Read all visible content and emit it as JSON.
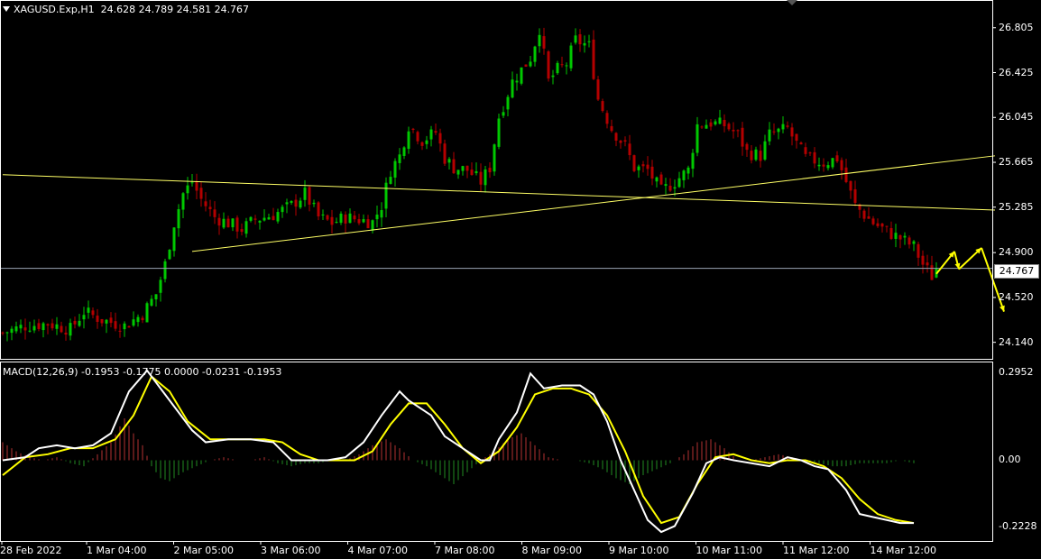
{
  "header": {
    "symbol": "XAGUSD.Exp,H1",
    "ohlc": "24.628 24.789 24.581 24.767"
  },
  "macd_header": {
    "text": "MACD(12,26,9) -0.1953 -0.1775 0.0000 -0.0231 -0.1953"
  },
  "current_price_label": "24.767",
  "colors": {
    "background": "#000000",
    "bull_candle": "#00c800",
    "bear_candle": "#b40000",
    "trendline": "#ffff66",
    "macd_line": "#ffffff",
    "signal_line": "#ffff00",
    "hist_positive": "#b43232",
    "hist_negative": "#228b22",
    "arrow": "#ffff00"
  },
  "chart_data": [
    {
      "type": "candlestick",
      "symbol": "XAGUSD.Exp",
      "timeframe": "H1",
      "ylim": [
        24.0,
        27.04
      ],
      "y_ticks": [
        "26.805",
        "26.425",
        "26.045",
        "25.665",
        "25.285",
        "24.900",
        "24.520",
        "24.140"
      ],
      "current_price": 24.767,
      "x_ticks": [
        "28 Feb 2022",
        "1 Mar 04:00",
        "2 Mar 05:00",
        "3 Mar 06:00",
        "4 Mar 07:00",
        "7 Mar 08:00",
        "8 Mar 09:00",
        "9 Mar 10:00",
        "10 Mar 11:00",
        "11 Mar 12:00",
        "14 Mar 12:00"
      ],
      "close_path": [
        [
          0,
          24.22
        ],
        [
          5,
          24.28
        ],
        [
          10,
          24.3
        ],
        [
          15,
          24.25
        ],
        [
          18,
          24.4
        ],
        [
          22,
          24.33
        ],
        [
          27,
          24.28
        ],
        [
          31,
          24.38
        ],
        [
          34,
          24.55
        ],
        [
          36,
          24.8
        ],
        [
          38,
          25.15
        ],
        [
          40,
          25.4
        ],
        [
          42,
          25.5
        ],
        [
          44,
          25.35
        ],
        [
          47,
          25.2
        ],
        [
          50,
          25.15
        ],
        [
          53,
          25.1
        ],
        [
          56,
          25.18
        ],
        [
          60,
          25.22
        ],
        [
          64,
          25.3
        ],
        [
          67,
          25.4
        ],
        [
          70,
          25.2
        ],
        [
          73,
          25.15
        ],
        [
          76,
          25.2
        ],
        [
          79,
          25.18
        ],
        [
          82,
          25.16
        ],
        [
          84,
          25.3
        ],
        [
          86,
          25.6
        ],
        [
          88,
          25.72
        ],
        [
          90,
          25.98
        ],
        [
          93,
          25.85
        ],
        [
          96,
          25.92
        ],
        [
          98,
          25.7
        ],
        [
          100,
          25.62
        ],
        [
          103,
          25.6
        ],
        [
          106,
          25.5
        ],
        [
          108,
          25.62
        ],
        [
          110,
          26.05
        ],
        [
          113,
          26.35
        ],
        [
          117,
          26.55
        ],
        [
          119,
          26.8
        ],
        [
          121,
          26.35
        ],
        [
          123,
          26.45
        ],
        [
          125,
          26.5
        ],
        [
          127,
          26.7
        ],
        [
          130,
          26.65
        ],
        [
          132,
          26.2
        ],
        [
          135,
          25.95
        ],
        [
          138,
          25.8
        ],
        [
          140,
          25.62
        ],
        [
          143,
          25.6
        ],
        [
          146,
          25.42
        ],
        [
          149,
          25.5
        ],
        [
          152,
          25.6
        ],
        [
          154,
          25.98
        ],
        [
          157,
          26.0
        ],
        [
          160,
          25.98
        ],
        [
          163,
          25.9
        ],
        [
          165,
          25.75
        ],
        [
          168,
          25.72
        ],
        [
          170,
          25.9
        ],
        [
          174,
          25.95
        ],
        [
          176,
          25.82
        ],
        [
          178,
          25.7
        ],
        [
          182,
          25.66
        ],
        [
          185,
          25.7
        ],
        [
          187,
          25.5
        ],
        [
          189,
          25.3
        ],
        [
          191,
          25.22
        ],
        [
          193,
          25.15
        ],
        [
          196,
          25.08
        ],
        [
          199,
          25.02
        ],
        [
          202,
          24.95
        ],
        [
          204,
          24.8
        ],
        [
          206,
          24.7
        ],
        [
          207,
          24.77
        ]
      ],
      "trendlines": [
        {
          "from": [
            0,
            25.56
          ],
          "to": [
            220,
            25.26
          ]
        },
        {
          "from": [
            42,
            24.91
          ],
          "to": [
            220,
            25.72
          ]
        }
      ],
      "projection_arrows": [
        {
          "from": [
            207,
            24.72
          ],
          "to": [
            211,
            24.91
          ]
        },
        {
          "from": [
            211,
            24.91
          ],
          "to": [
            212,
            24.76
          ]
        },
        {
          "from": [
            212,
            24.76
          ],
          "to": [
            217,
            24.94
          ]
        },
        {
          "from": [
            217,
            24.94
          ],
          "to": [
            222,
            24.4
          ]
        }
      ]
    },
    {
      "type": "line",
      "name": "MACD(12,26,9)",
      "ylim": [
        -0.27,
        0.33
      ],
      "y_ticks": [
        "0.2952",
        "0.00",
        "-0.2228"
      ],
      "macd": [
        [
          0,
          0.0
        ],
        [
          5,
          0.01
        ],
        [
          8,
          0.04
        ],
        [
          12,
          0.05
        ],
        [
          16,
          0.04
        ],
        [
          20,
          0.05
        ],
        [
          24,
          0.09
        ],
        [
          28,
          0.23
        ],
        [
          32,
          0.3
        ],
        [
          35,
          0.24
        ],
        [
          38,
          0.18
        ],
        [
          42,
          0.1
        ],
        [
          45,
          0.06
        ],
        [
          50,
          0.07
        ],
        [
          55,
          0.07
        ],
        [
          60,
          0.06
        ],
        [
          64,
          0.0
        ],
        [
          68,
          0.0
        ],
        [
          72,
          0.0
        ],
        [
          76,
          0.01
        ],
        [
          80,
          0.06
        ],
        [
          84,
          0.15
        ],
        [
          88,
          0.23
        ],
        [
          90,
          0.2
        ],
        [
          95,
          0.15
        ],
        [
          98,
          0.08
        ],
        [
          102,
          0.04
        ],
        [
          106,
          0.0
        ],
        [
          108,
          0.0
        ],
        [
          110,
          0.07
        ],
        [
          114,
          0.16
        ],
        [
          117,
          0.29
        ],
        [
          120,
          0.24
        ],
        [
          124,
          0.25
        ],
        [
          128,
          0.25
        ],
        [
          131,
          0.22
        ],
        [
          134,
          0.13
        ],
        [
          137,
          0.0
        ],
        [
          140,
          -0.1
        ],
        [
          143,
          -0.2
        ],
        [
          146,
          -0.24
        ],
        [
          149,
          -0.22
        ],
        [
          153,
          -0.11
        ],
        [
          156,
          -0.01
        ],
        [
          159,
          0.01
        ],
        [
          162,
          0.0
        ],
        [
          166,
          -0.01
        ],
        [
          170,
          -0.02
        ],
        [
          174,
          0.01
        ],
        [
          177,
          0.0
        ],
        [
          180,
          -0.02
        ],
        [
          183,
          -0.03
        ],
        [
          187,
          -0.1
        ],
        [
          190,
          -0.18
        ],
        [
          193,
          -0.19
        ],
        [
          196,
          -0.2
        ],
        [
          199,
          -0.21
        ],
        [
          202,
          -0.21
        ]
      ],
      "signal": [
        [
          0,
          -0.05
        ],
        [
          5,
          0.01
        ],
        [
          10,
          0.02
        ],
        [
          15,
          0.04
        ],
        [
          20,
          0.04
        ],
        [
          25,
          0.07
        ],
        [
          29,
          0.15
        ],
        [
          33,
          0.28
        ],
        [
          37,
          0.23
        ],
        [
          41,
          0.13
        ],
        [
          46,
          0.07
        ],
        [
          52,
          0.07
        ],
        [
          58,
          0.07
        ],
        [
          62,
          0.06
        ],
        [
          66,
          0.02
        ],
        [
          70,
          0.0
        ],
        [
          74,
          0.0
        ],
        [
          78,
          0.0
        ],
        [
          82,
          0.03
        ],
        [
          86,
          0.12
        ],
        [
          90,
          0.19
        ],
        [
          94,
          0.19
        ],
        [
          98,
          0.12
        ],
        [
          102,
          0.04
        ],
        [
          106,
          -0.01
        ],
        [
          110,
          0.03
        ],
        [
          114,
          0.11
        ],
        [
          118,
          0.22
        ],
        [
          122,
          0.24
        ],
        [
          126,
          0.24
        ],
        [
          130,
          0.22
        ],
        [
          134,
          0.15
        ],
        [
          138,
          0.03
        ],
        [
          142,
          -0.12
        ],
        [
          146,
          -0.21
        ],
        [
          150,
          -0.19
        ],
        [
          154,
          -0.08
        ],
        [
          158,
          0.01
        ],
        [
          162,
          0.02
        ],
        [
          166,
          0.0
        ],
        [
          170,
          -0.01
        ],
        [
          174,
          0.0
        ],
        [
          178,
          0.0
        ],
        [
          182,
          -0.02
        ],
        [
          186,
          -0.06
        ],
        [
          190,
          -0.13
        ],
        [
          194,
          -0.18
        ],
        [
          198,
          -0.2
        ],
        [
          202,
          -0.21
        ]
      ],
      "histogram": [
        [
          0,
          0.06
        ],
        [
          3,
          0.03
        ],
        [
          6,
          0.01
        ],
        [
          9,
          0.0
        ],
        [
          12,
          0.01
        ],
        [
          15,
          -0.01
        ],
        [
          18,
          -0.02
        ],
        [
          21,
          0.02
        ],
        [
          24,
          0.06
        ],
        [
          27,
          0.14
        ],
        [
          29,
          0.09
        ],
        [
          31,
          0.05
        ],
        [
          33,
          -0.02
        ],
        [
          35,
          -0.06
        ],
        [
          37,
          -0.07
        ],
        [
          40,
          -0.04
        ],
        [
          43,
          -0.02
        ],
        [
          46,
          0.0
        ],
        [
          49,
          0.01
        ],
        [
          52,
          0.0
        ],
        [
          55,
          0.0
        ],
        [
          58,
          0.01
        ],
        [
          61,
          -0.01
        ],
        [
          64,
          -0.02
        ],
        [
          67,
          -0.01
        ],
        [
          70,
          -0.01
        ],
        [
          73,
          0.0
        ],
        [
          76,
          0.0
        ],
        [
          79,
          0.02
        ],
        [
          82,
          0.05
        ],
        [
          85,
          0.07
        ],
        [
          88,
          0.04
        ],
        [
          91,
          0.0
        ],
        [
          94,
          -0.02
        ],
        [
          97,
          -0.05
        ],
        [
          100,
          -0.08
        ],
        [
          103,
          -0.04
        ],
        [
          106,
          0.0
        ],
        [
          109,
          0.03
        ],
        [
          112,
          0.07
        ],
        [
          115,
          0.09
        ],
        [
          118,
          0.05
        ],
        [
          121,
          0.01
        ],
        [
          124,
          0.0
        ],
        [
          127,
          0.0
        ],
        [
          130,
          -0.01
        ],
        [
          133,
          -0.03
        ],
        [
          136,
          -0.06
        ],
        [
          139,
          -0.08
        ],
        [
          142,
          -0.05
        ],
        [
          145,
          -0.03
        ],
        [
          148,
          -0.01
        ],
        [
          151,
          0.02
        ],
        [
          154,
          0.06
        ],
        [
          157,
          0.07
        ],
        [
          160,
          0.04
        ],
        [
          163,
          0.0
        ],
        [
          166,
          0.0
        ],
        [
          169,
          0.01
        ],
        [
          172,
          0.02
        ],
        [
          175,
          0.01
        ],
        [
          178,
          0.0
        ],
        [
          181,
          -0.01
        ],
        [
          184,
          -0.02
        ],
        [
          187,
          -0.02
        ],
        [
          190,
          -0.01
        ],
        [
          193,
          -0.01
        ],
        [
          196,
          -0.01
        ],
        [
          199,
          0.0
        ],
        [
          202,
          -0.01
        ]
      ]
    }
  ]
}
